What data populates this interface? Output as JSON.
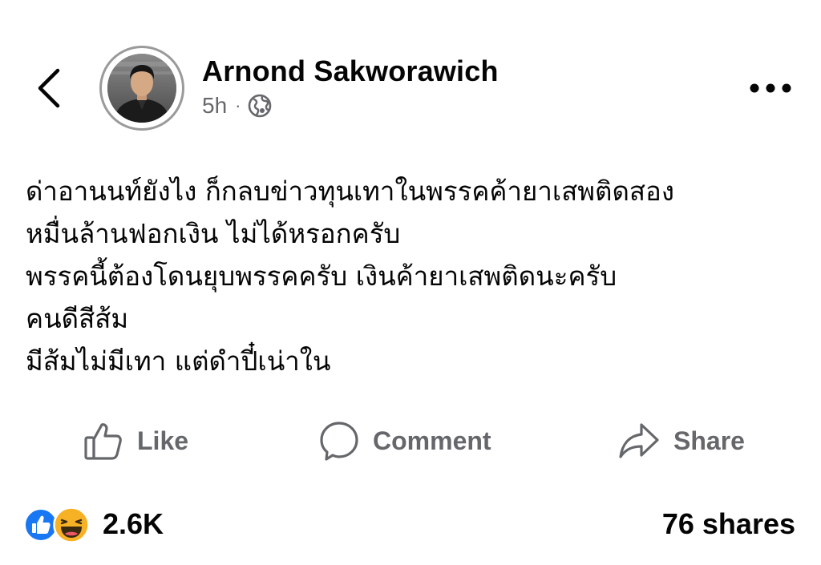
{
  "header": {
    "back_icon": "chevron-left-icon",
    "author_name": "Arnond Sakworawich",
    "timestamp": "5h",
    "separator": "·",
    "privacy_icon": "globe-icon",
    "more_icon": "more-horizontal-icon"
  },
  "post": {
    "lines": [
      "ด่าอานนท์ยังไง ก็กลบข่าวทุนเทาในพรรคค้ายาเสพติดสอง",
      "หมื่นล้านฟอกเงิน ไม่ได้หรอกครับ",
      "พรรคนี้ต้องโดนยุบพรรคครับ เงินค้ายาเสพติดนะครับ",
      "คนดีสีส้ม",
      "มีส้มไม่มีเทา แต่ดำปี๋เน่าใน"
    ]
  },
  "actions": {
    "like_label": "Like",
    "comment_label": "Comment",
    "share_label": "Share"
  },
  "stats": {
    "reactions_count": "2.6K",
    "reaction_icons": [
      "like-reaction-icon",
      "haha-reaction-icon"
    ],
    "shares": "76 shares"
  },
  "colors": {
    "text_primary": "#050505",
    "text_secondary": "#65676b",
    "like_blue": "#1877f2",
    "haha_yellow": "#f7b125"
  }
}
